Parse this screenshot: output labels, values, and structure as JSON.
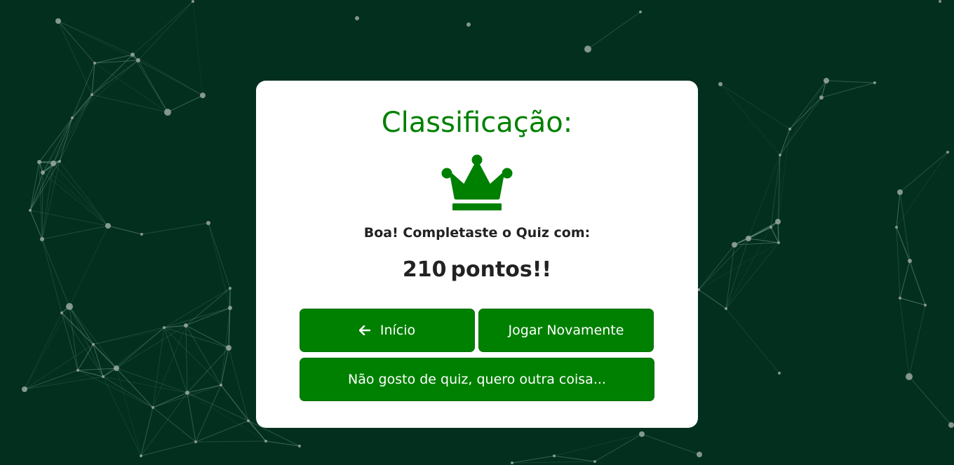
{
  "result": {
    "title": "Classificação:",
    "crown_icon": "crown-icon",
    "message": "Boa! Completaste o Quiz com:",
    "score_value": "210",
    "score_suffix": "pontos!!"
  },
  "actions": {
    "home_label": "Início",
    "home_icon": "arrow-left-icon",
    "play_again_label": "Jogar Novamente",
    "other_label": "Não gosto de quiz, quero outra coisa..."
  },
  "colors": {
    "background": "#022f1e",
    "accent": "#008000",
    "card": "#ffffff",
    "text": "#222222"
  }
}
